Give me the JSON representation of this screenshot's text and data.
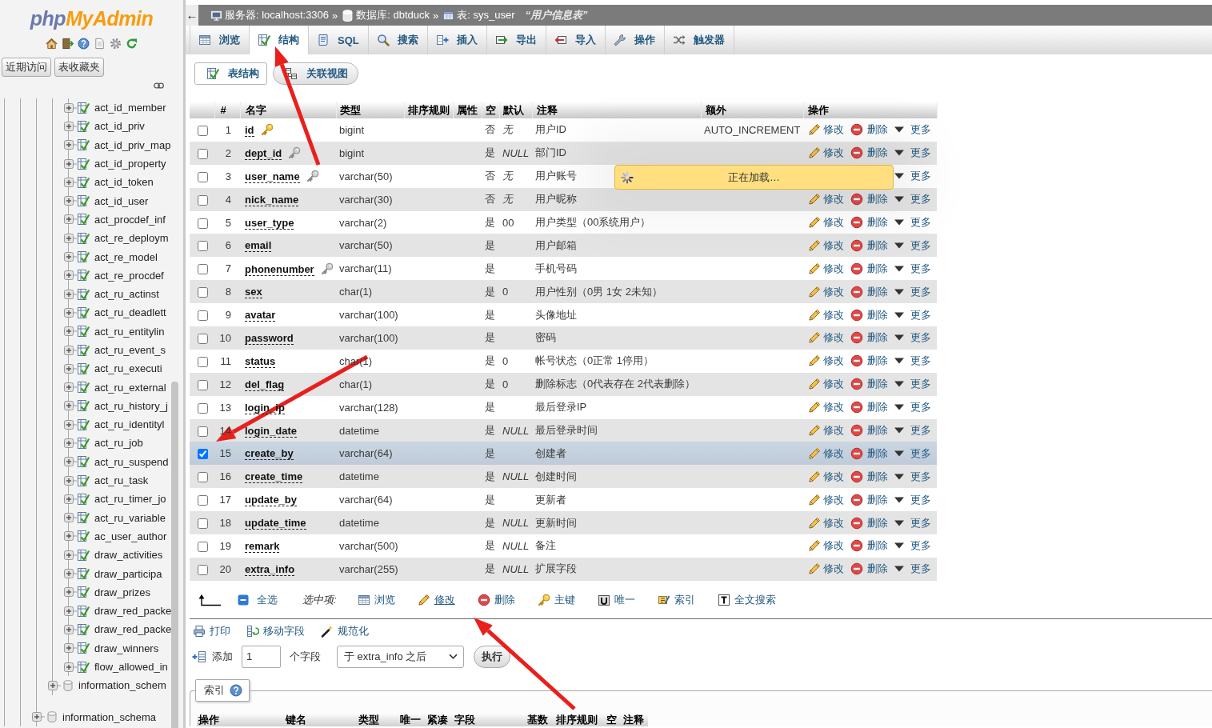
{
  "sidebar": {
    "logo": {
      "prefix": "php",
      "name": "MyAdmin"
    },
    "buttons": [
      "近期访问",
      "表收藏夹"
    ],
    "tree": [
      {
        "children": [
          {
            "children": [
              {
                "children": [
                  {
                    "children": [
                      {
                        "kind": "table",
                        "label": "act_id_member"
                      },
                      {
                        "kind": "table",
                        "label": "act_id_priv"
                      },
                      {
                        "kind": "table",
                        "label": "act_id_priv_map"
                      },
                      {
                        "kind": "table",
                        "label": "act_id_property"
                      },
                      {
                        "kind": "table",
                        "label": "act_id_token"
                      },
                      {
                        "kind": "table",
                        "label": "act_id_user"
                      },
                      {
                        "kind": "table",
                        "label": "act_procdef_inf"
                      },
                      {
                        "kind": "table",
                        "label": "act_re_deploym"
                      },
                      {
                        "kind": "table",
                        "label": "act_re_model"
                      },
                      {
                        "kind": "table",
                        "label": "act_re_procdef"
                      },
                      {
                        "kind": "table",
                        "label": "act_ru_actinst"
                      },
                      {
                        "kind": "table",
                        "label": "act_ru_deadlett"
                      },
                      {
                        "kind": "table",
                        "label": "act_ru_entitylin"
                      },
                      {
                        "kind": "table",
                        "label": "act_ru_event_s"
                      },
                      {
                        "kind": "table",
                        "label": "act_ru_executi"
                      },
                      {
                        "kind": "table",
                        "label": "act_ru_external"
                      },
                      {
                        "kind": "table",
                        "label": "act_ru_history_j"
                      },
                      {
                        "kind": "table",
                        "label": "act_ru_identityl"
                      },
                      {
                        "kind": "table",
                        "label": "act_ru_job"
                      },
                      {
                        "kind": "table",
                        "label": "act_ru_suspend"
                      },
                      {
                        "kind": "table",
                        "label": "act_ru_task"
                      },
                      {
                        "kind": "table",
                        "label": "act_ru_timer_jo"
                      },
                      {
                        "kind": "table",
                        "label": "act_ru_variable"
                      },
                      {
                        "kind": "table",
                        "label": "ac_user_author"
                      },
                      {
                        "kind": "table",
                        "label": "draw_activities"
                      },
                      {
                        "kind": "table",
                        "label": "draw_participa"
                      },
                      {
                        "kind": "table",
                        "label": "draw_prizes"
                      },
                      {
                        "kind": "table",
                        "label": "draw_red_packe"
                      },
                      {
                        "kind": "table",
                        "label": "draw_red_packe"
                      },
                      {
                        "kind": "table",
                        "label": "draw_winners"
                      },
                      {
                        "kind": "table",
                        "label": "flow_allowed_in"
                      }
                    ]
                  },
                  {
                    "kind": "database",
                    "label": "information_schem"
                  }
                ]
              },
              {
                "kind": "database",
                "label": "information_schema"
              }
            ]
          }
        ]
      }
    ]
  },
  "breadcrumb": {
    "back": "←",
    "items": [
      {
        "kind": "server",
        "label": "服务器: localhost:3306",
        "separator": "»"
      },
      {
        "kind": "database",
        "label": "数据库: dbtduck",
        "separator": "»"
      },
      {
        "kind": "table",
        "label": "表: sys_user"
      }
    ],
    "comment": "“用户信息表”"
  },
  "tabs": [
    {
      "kind": "browse",
      "label": "浏览",
      "selected": false
    },
    {
      "kind": "structure",
      "label": "结构",
      "selected": true
    },
    {
      "kind": "sql",
      "label": "SQL",
      "selected": false
    },
    {
      "kind": "search",
      "label": "搜索",
      "selected": false
    },
    {
      "kind": "insert",
      "label": "插入",
      "selected": false
    },
    {
      "kind": "export",
      "label": "导出",
      "selected": false
    },
    {
      "kind": "import",
      "label": "导入",
      "selected": false
    },
    {
      "kind": "operations",
      "label": "操作",
      "selected": false
    },
    {
      "kind": "triggers",
      "label": "触发器",
      "selected": false
    }
  ],
  "subtabs": [
    {
      "kind": "structure",
      "label": "表结构",
      "selected": true
    },
    {
      "kind": "relation",
      "label": "关联视图",
      "selected": false
    }
  ],
  "table": {
    "columns": [
      "#",
      "名字",
      "类型",
      "排序规则",
      "属性",
      "空",
      "默认",
      "注释",
      "额外",
      "操作"
    ],
    "rows": [
      {
        "number": "1",
        "name": "id",
        "key": {
          "kind": "primary"
        },
        "type": "bigint",
        "null": "否",
        "default": {
          "kind": "keyword",
          "text": "无"
        },
        "comment": "用户ID",
        "extra": "AUTO_INCREMENT",
        "selected": false,
        "actions": [
          {
            "kind": "edit",
            "label": "修改"
          },
          {
            "kind": "delete",
            "label": "删除"
          },
          {
            "kind": "more",
            "label": "更多"
          }
        ]
      },
      {
        "number": "2",
        "name": "dept_id",
        "key": {
          "kind": "index"
        },
        "type": "bigint",
        "null": "是",
        "default": {
          "kind": "keyword",
          "text": "NULL"
        },
        "comment": "部门ID",
        "selected": false,
        "actions": [
          {
            "kind": "edit",
            "label": "修改"
          },
          {
            "kind": "delete",
            "label": "删除"
          },
          {
            "kind": "more",
            "label": "更多"
          }
        ]
      },
      {
        "number": "3",
        "name": "user_name",
        "key": {
          "kind": "index"
        },
        "type": "varchar(50)",
        "null": "否",
        "default": {
          "kind": "keyword",
          "text": "无"
        },
        "comment": "用户账号",
        "selected": false,
        "actions": [
          {
            "kind": "more",
            "label": "更多"
          }
        ]
      },
      {
        "number": "4",
        "name": "nick_name",
        "type": "varchar(30)",
        "null": "否",
        "default": {
          "kind": "keyword",
          "text": "无"
        },
        "comment": "用户昵称",
        "selected": false,
        "actions": [
          {
            "kind": "edit",
            "label": "修改"
          },
          {
            "kind": "delete",
            "label": "删除"
          },
          {
            "kind": "more",
            "label": "更多"
          }
        ]
      },
      {
        "number": "5",
        "name": "user_type",
        "type": "varchar(2)",
        "null": "是",
        "default": {
          "kind": "literal",
          "text": "00"
        },
        "comment": "用户类型（00系统用户）",
        "selected": false,
        "actions": [
          {
            "kind": "edit",
            "label": "修改"
          },
          {
            "kind": "delete",
            "label": "删除"
          },
          {
            "kind": "more",
            "label": "更多"
          }
        ]
      },
      {
        "number": "6",
        "name": "email",
        "type": "varchar(50)",
        "null": "是",
        "comment": "用户邮箱",
        "selected": false,
        "actions": [
          {
            "kind": "edit",
            "label": "修改"
          },
          {
            "kind": "delete",
            "label": "删除"
          },
          {
            "kind": "more",
            "label": "更多"
          }
        ]
      },
      {
        "number": "7",
        "name": "phonenumber",
        "key": {
          "kind": "index"
        },
        "type": "varchar(11)",
        "null": "是",
        "comment": "手机号码",
        "selected": false,
        "actions": [
          {
            "kind": "edit",
            "label": "修改"
          },
          {
            "kind": "delete",
            "label": "删除"
          },
          {
            "kind": "more",
            "label": "更多"
          }
        ]
      },
      {
        "number": "8",
        "name": "sex",
        "type": "char(1)",
        "null": "是",
        "default": {
          "kind": "literal",
          "text": "0"
        },
        "comment": "用户性别（0男 1女 2未知）",
        "selected": false,
        "actions": [
          {
            "kind": "edit",
            "label": "修改"
          },
          {
            "kind": "delete",
            "label": "删除"
          },
          {
            "kind": "more",
            "label": "更多"
          }
        ]
      },
      {
        "number": "9",
        "name": "avatar",
        "type": "varchar(100)",
        "null": "是",
        "comment": "头像地址",
        "selected": false,
        "actions": [
          {
            "kind": "edit",
            "label": "修改"
          },
          {
            "kind": "delete",
            "label": "删除"
          },
          {
            "kind": "more",
            "label": "更多"
          }
        ]
      },
      {
        "number": "10",
        "name": "password",
        "type": "varchar(100)",
        "null": "是",
        "comment": "密码",
        "selected": false,
        "actions": [
          {
            "kind": "edit",
            "label": "修改"
          },
          {
            "kind": "delete",
            "label": "删除"
          },
          {
            "kind": "more",
            "label": "更多"
          }
        ]
      },
      {
        "number": "11",
        "name": "status",
        "type": "char(1)",
        "null": "是",
        "default": {
          "kind": "literal",
          "text": "0"
        },
        "comment": "帐号状态（0正常 1停用）",
        "selected": false,
        "actions": [
          {
            "kind": "edit",
            "label": "修改"
          },
          {
            "kind": "delete",
            "label": "删除"
          },
          {
            "kind": "more",
            "label": "更多"
          }
        ]
      },
      {
        "number": "12",
        "name": "del_flag",
        "type": "char(1)",
        "null": "是",
        "default": {
          "kind": "literal",
          "text": "0"
        },
        "comment": "删除标志（0代表存在 2代表删除）",
        "selected": false,
        "actions": [
          {
            "kind": "edit",
            "label": "修改"
          },
          {
            "kind": "delete",
            "label": "删除"
          },
          {
            "kind": "more",
            "label": "更多"
          }
        ]
      },
      {
        "number": "13",
        "name": "login_ip",
        "type": "varchar(128)",
        "null": "是",
        "comment": "最后登录IP",
        "selected": false,
        "actions": [
          {
            "kind": "edit",
            "label": "修改"
          },
          {
            "kind": "delete",
            "label": "删除"
          },
          {
            "kind": "more",
            "label": "更多"
          }
        ]
      },
      {
        "number": "14",
        "name": "login_date",
        "type": "datetime",
        "null": "是",
        "default": {
          "kind": "keyword",
          "text": "NULL"
        },
        "comment": "最后登录时间",
        "selected": false,
        "actions": [
          {
            "kind": "edit",
            "label": "修改"
          },
          {
            "kind": "delete",
            "label": "删除"
          },
          {
            "kind": "more",
            "label": "更多"
          }
        ]
      },
      {
        "number": "15",
        "name": "create_by",
        "type": "varchar(64)",
        "null": "是",
        "comment": "创建者",
        "selected": true,
        "actions": [
          {
            "kind": "edit",
            "label": "修改"
          },
          {
            "kind": "delete",
            "label": "删除"
          },
          {
            "kind": "more",
            "label": "更多"
          }
        ]
      },
      {
        "number": "16",
        "name": "create_time",
        "type": "datetime",
        "null": "是",
        "default": {
          "kind": "keyword",
          "text": "NULL"
        },
        "comment": "创建时间",
        "selected": false,
        "actions": [
          {
            "kind": "edit",
            "label": "修改"
          },
          {
            "kind": "delete",
            "label": "删除"
          },
          {
            "kind": "more",
            "label": "更多"
          }
        ]
      },
      {
        "number": "17",
        "name": "update_by",
        "type": "varchar(64)",
        "null": "是",
        "comment": "更新者",
        "selected": false,
        "actions": [
          {
            "kind": "edit",
            "label": "修改"
          },
          {
            "kind": "delete",
            "label": "删除"
          },
          {
            "kind": "more",
            "label": "更多"
          }
        ]
      },
      {
        "number": "18",
        "name": "update_time",
        "type": "datetime",
        "null": "是",
        "default": {
          "kind": "keyword",
          "text": "NULL"
        },
        "comment": "更新时间",
        "selected": false,
        "actions": [
          {
            "kind": "edit",
            "label": "修改"
          },
          {
            "kind": "delete",
            "label": "删除"
          },
          {
            "kind": "more",
            "label": "更多"
          }
        ]
      },
      {
        "number": "19",
        "name": "remark",
        "type": "varchar(500)",
        "null": "是",
        "default": {
          "kind": "keyword",
          "text": "NULL"
        },
        "comment": "备注",
        "selected": false,
        "actions": [
          {
            "kind": "edit",
            "label": "修改"
          },
          {
            "kind": "delete",
            "label": "删除"
          },
          {
            "kind": "more",
            "label": "更多"
          }
        ]
      },
      {
        "number": "20",
        "name": "extra_info",
        "type": "varchar(255)",
        "null": "是",
        "default": {
          "kind": "keyword",
          "text": "NULL"
        },
        "comment": "扩展字段",
        "selected": false,
        "actions": [
          {
            "kind": "edit",
            "label": "修改"
          },
          {
            "kind": "delete",
            "label": "删除"
          },
          {
            "kind": "more",
            "label": "更多"
          }
        ]
      }
    ]
  },
  "loading": {
    "text": "正在加载…"
  },
  "bulk": {
    "select_all": "全选",
    "with_selected": "选中项:",
    "actions": [
      {
        "kind": "browse",
        "label": "浏览",
        "hovered": false
      },
      {
        "kind": "edit",
        "label": "修改",
        "hovered": true
      },
      {
        "kind": "delete",
        "label": "删除",
        "hovered": false
      },
      {
        "kind": "primary",
        "label": "主键",
        "hovered": false
      },
      {
        "kind": "unique",
        "label": "唯一",
        "hovered": false
      },
      {
        "kind": "index",
        "label": "索引",
        "hovered": false
      },
      {
        "kind": "fulltext",
        "label": "全文搜索",
        "hovered": false
      }
    ]
  },
  "tools": [
    {
      "kind": "print",
      "label": "打印"
    },
    {
      "kind": "move",
      "label": "移动字段"
    },
    {
      "kind": "normalize",
      "label": "规范化"
    }
  ],
  "add_column": {
    "label": "添加",
    "value": "1",
    "unit": "个字段",
    "position": "于 extra_info 之后",
    "button": "执行"
  },
  "indexes": {
    "legend": "索引",
    "columns": [
      "操作",
      "键名",
      "类型",
      "唯一",
      "紧凑",
      "字段",
      "基数",
      "排序规则",
      "空",
      "注释"
    ]
  }
}
